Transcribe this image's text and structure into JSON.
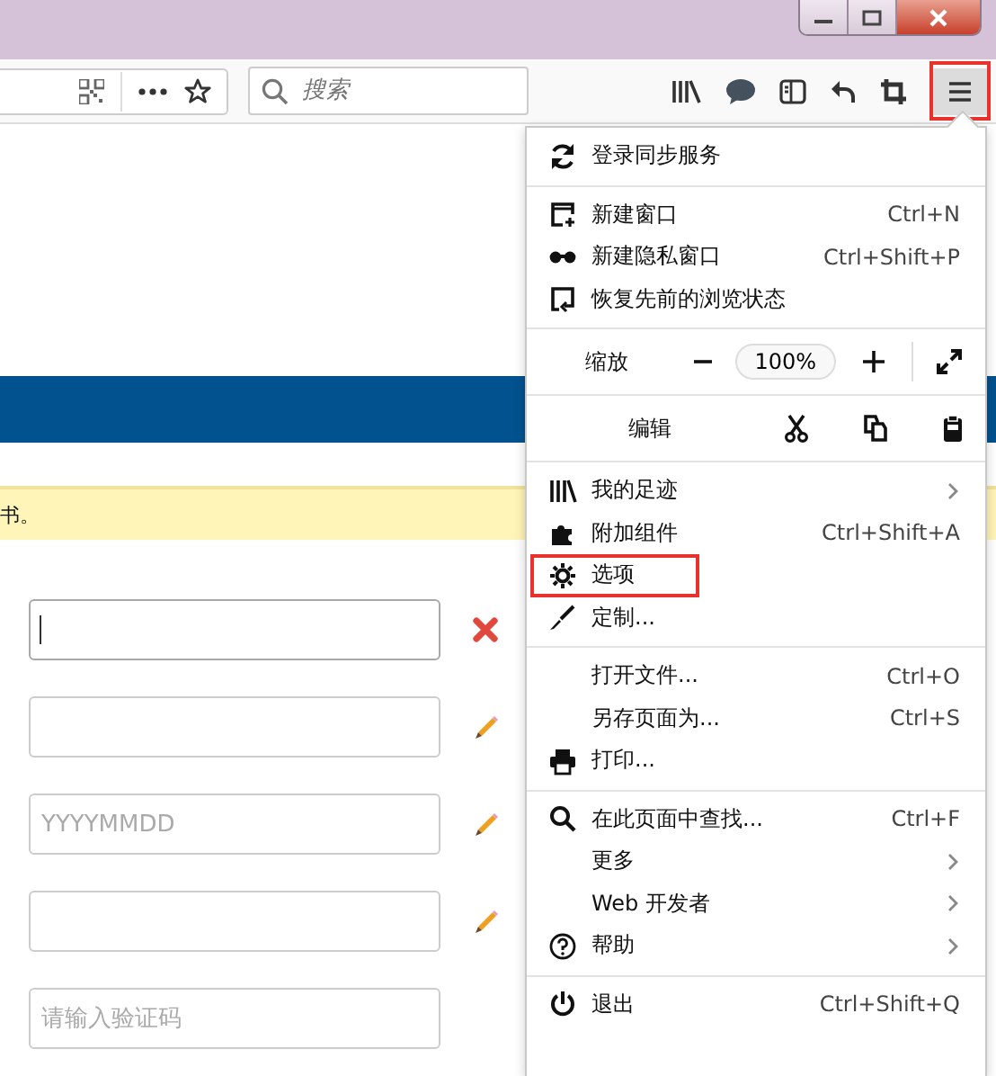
{
  "toolbar": {
    "search": {
      "placeholder": "搜索"
    },
    "menu_button": {
      "highlighted": true
    }
  },
  "page": {
    "notice": "书。",
    "fields": [
      {
        "focused": true,
        "kind": "error"
      },
      {
        "focused": false,
        "kind": "edit"
      },
      {
        "placeholder": "YYYYMMDD",
        "focused": false,
        "kind": "edit"
      },
      {
        "focused": false,
        "kind": "edit"
      },
      {
        "placeholder": "请输入验证码",
        "focused": false,
        "kind": "plain"
      }
    ]
  },
  "menu": {
    "sections": [
      [
        {
          "kind": "item",
          "label": "登录同步服务",
          "highlighted": false,
          "submenu": false
        }
      ],
      [
        {
          "kind": "item",
          "label": "新建窗口",
          "shortcut": "Ctrl+N",
          "highlighted": false,
          "submenu": false
        },
        {
          "kind": "item",
          "label": "新建隐私窗口",
          "shortcut": "Ctrl+Shift+P",
          "highlighted": false,
          "submenu": false
        },
        {
          "kind": "item",
          "label": "恢复先前的浏览状态",
          "highlighted": false,
          "submenu": false
        }
      ],
      [
        {
          "kind": "zoom",
          "label": "缩放",
          "reading": "100%"
        }
      ],
      [
        {
          "kind": "edit",
          "label": "编辑"
        }
      ],
      [
        {
          "kind": "item",
          "label": "我的足迹",
          "highlighted": false,
          "submenu": true
        },
        {
          "kind": "item",
          "label": "附加组件",
          "shortcut": "Ctrl+Shift+A",
          "highlighted": false,
          "submenu": false
        },
        {
          "kind": "item",
          "label": "选项",
          "highlighted": true,
          "submenu": false
        },
        {
          "kind": "item",
          "label": "定制...",
          "highlighted": false,
          "submenu": false
        }
      ],
      [
        {
          "kind": "item",
          "label": "打开文件...",
          "shortcut": "Ctrl+O",
          "highlighted": false,
          "submenu": false
        },
        {
          "kind": "item",
          "label": "另存页面为...",
          "shortcut": "Ctrl+S",
          "highlighted": false,
          "submenu": false
        },
        {
          "kind": "item",
          "label": "打印...",
          "highlighted": false,
          "submenu": false
        }
      ],
      [
        {
          "kind": "item",
          "label": "在此页面中查找...",
          "shortcut": "Ctrl+F",
          "highlighted": false,
          "submenu": false
        },
        {
          "kind": "item",
          "label": "更多",
          "highlighted": false,
          "submenu": true
        },
        {
          "kind": "item",
          "label": "Web 开发者",
          "highlighted": false,
          "submenu": true
        },
        {
          "kind": "item",
          "label": "帮助",
          "highlighted": false,
          "submenu": true
        }
      ],
      [
        {
          "kind": "item",
          "label": "退出",
          "shortcut": "Ctrl+Shift+Q",
          "highlighted": false,
          "submenu": false
        }
      ]
    ]
  }
}
